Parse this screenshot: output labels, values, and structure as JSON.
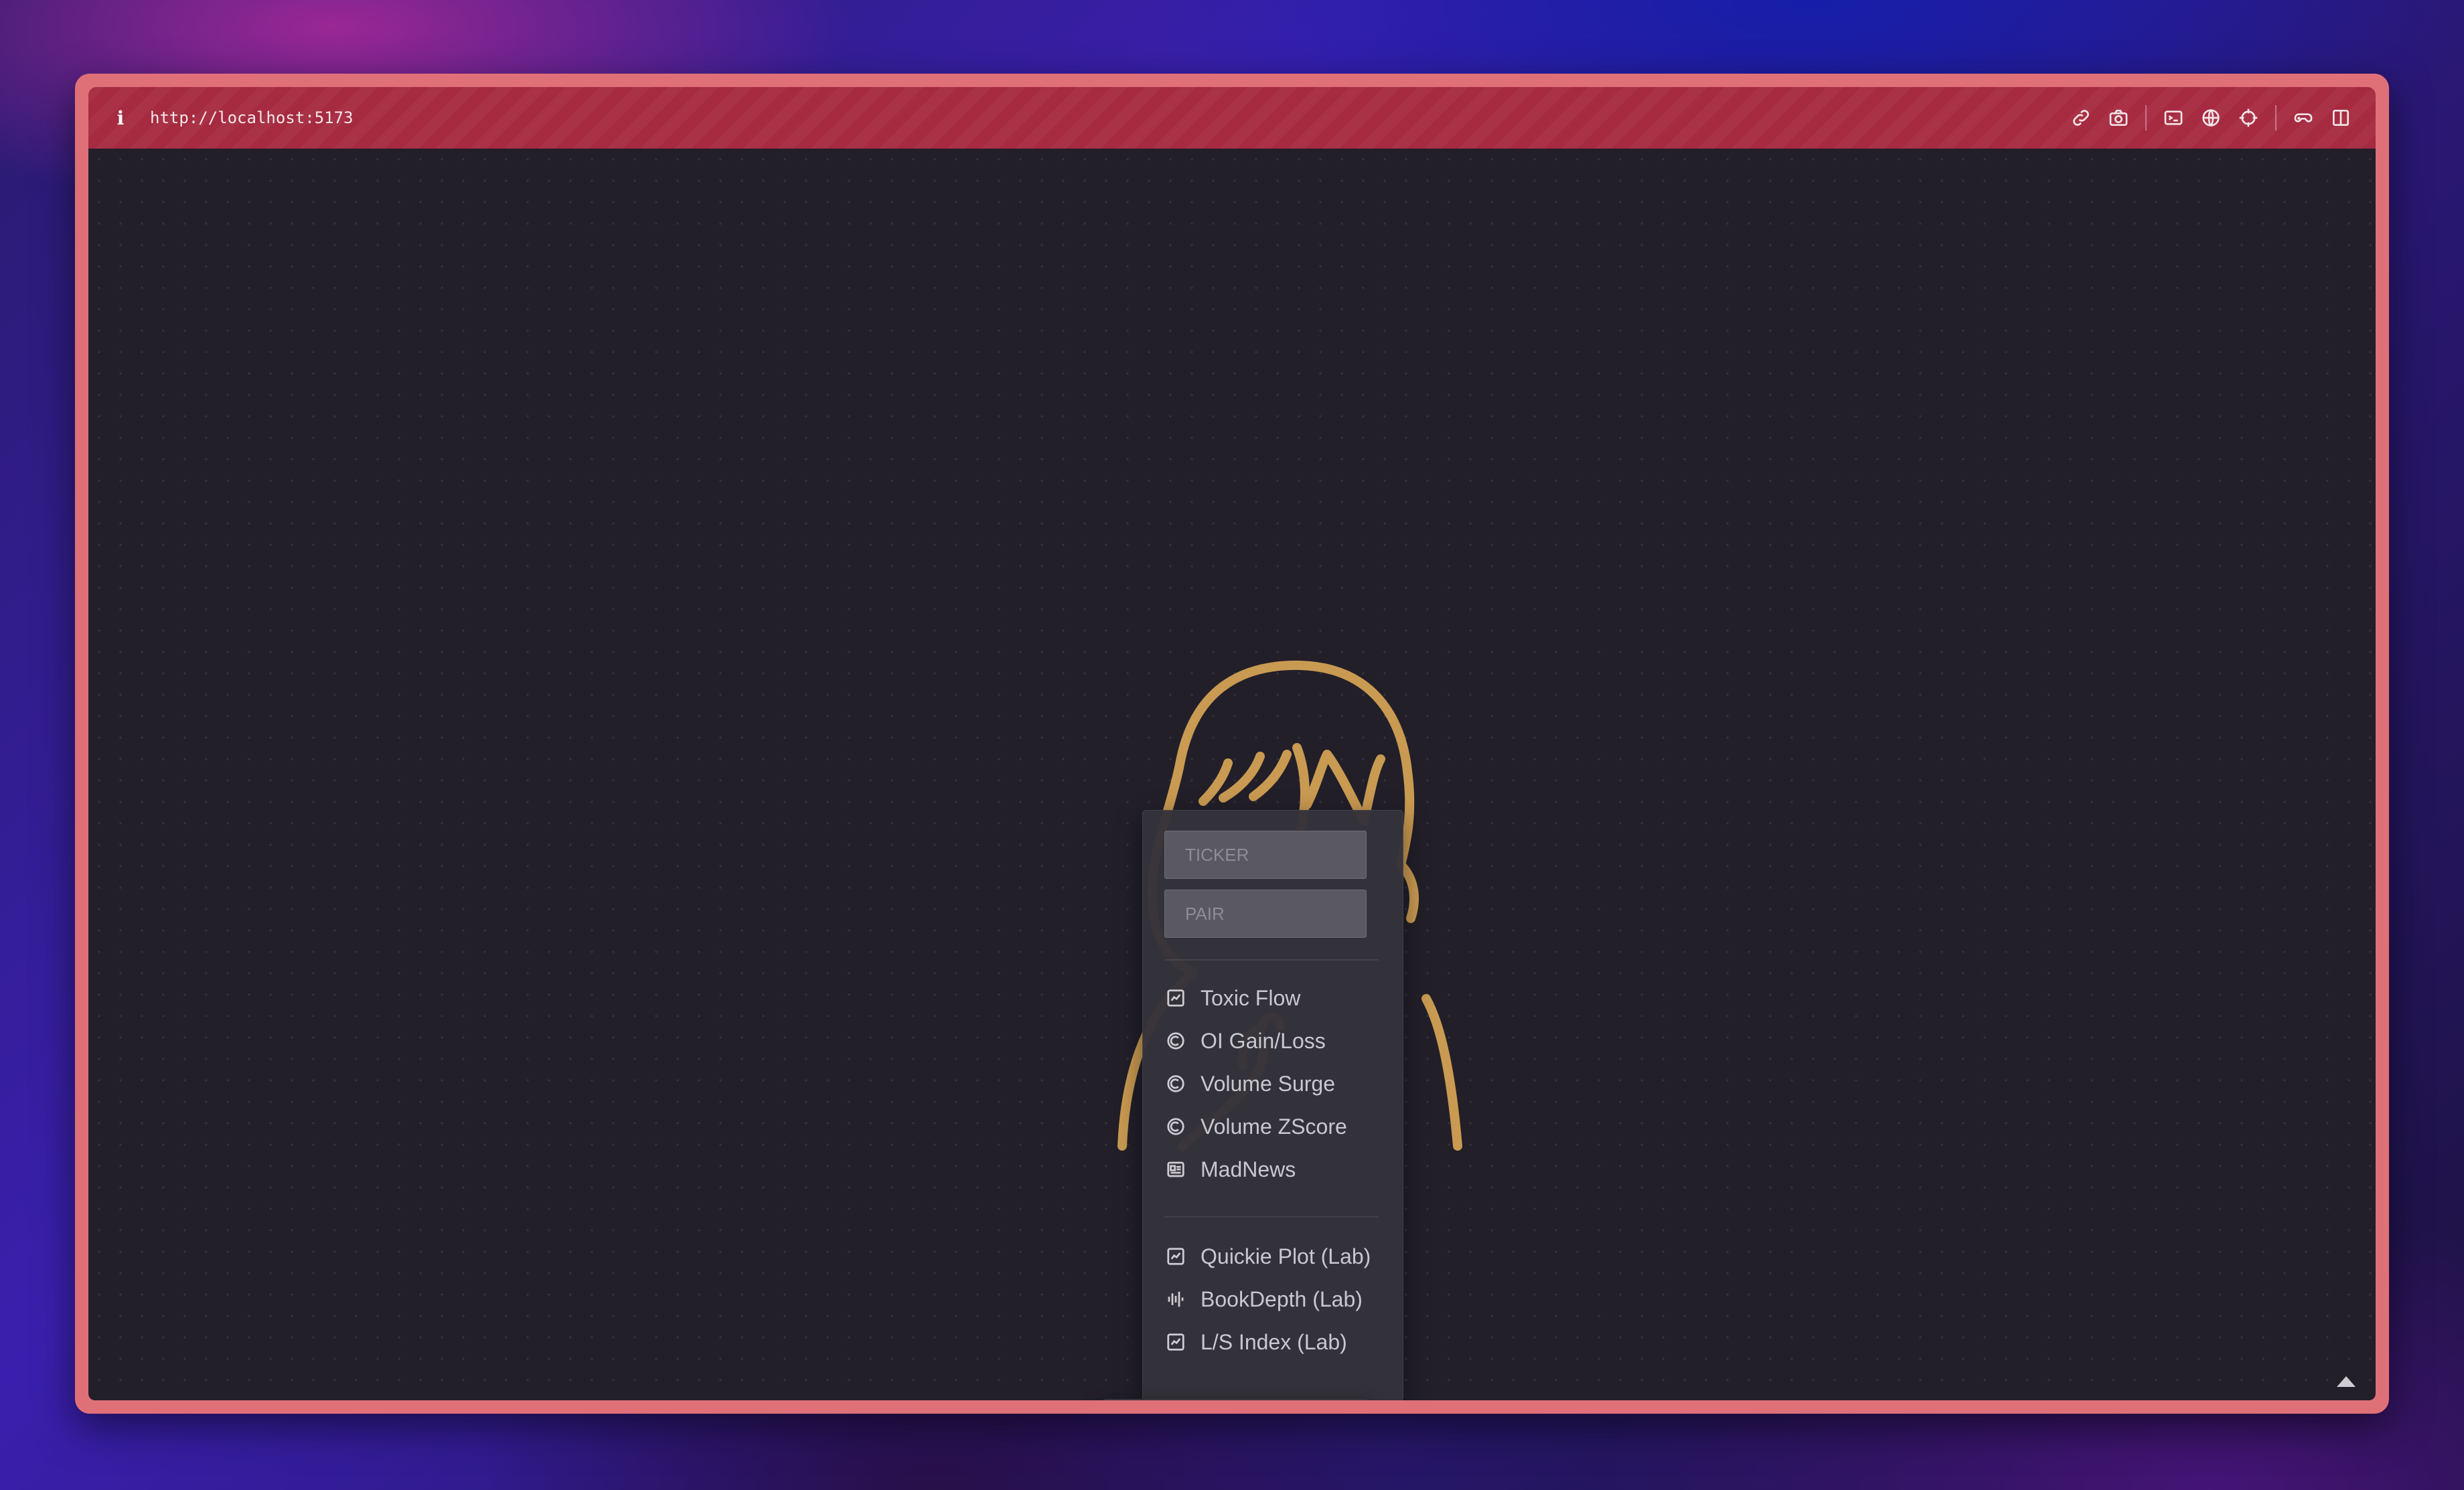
{
  "browser": {
    "url": "http://localhost:5173",
    "info_icon": "i",
    "toolbar_icons": [
      "link-icon",
      "camera-icon",
      "terminal-icon",
      "globe-icon",
      "crosshair-icon",
      "gamepad-icon",
      "split-view-icon"
    ]
  },
  "colors": {
    "titlebar": "#a62a40",
    "window_border": "#e07078",
    "canvas": "#221f29",
    "mascot_stroke": "#c99a52"
  },
  "menu": {
    "ticker_placeholder": "TICKER",
    "pair_placeholder": "PAIR",
    "items": [
      {
        "label": "Toxic Flow",
        "icon": "chart-icon"
      },
      {
        "label": "OI Gain/Loss",
        "icon": "gauge-icon"
      },
      {
        "label": "Volume Surge",
        "icon": "gauge-icon"
      },
      {
        "label": "Volume ZScore",
        "icon": "gauge-icon"
      },
      {
        "label": "MadNews",
        "icon": "news-icon"
      }
    ],
    "lab_items": [
      {
        "label": "Quickie Plot (Lab)",
        "icon": "chart-icon"
      },
      {
        "label": "BookDepth (Lab)",
        "icon": "depth-icon"
      },
      {
        "label": "L/S Index (Lab)",
        "icon": "chart-icon"
      }
    ]
  },
  "dock": {
    "buttons": [
      "grid-icon",
      "settings-icon",
      "plus-icon",
      "align-left-icon"
    ]
  }
}
